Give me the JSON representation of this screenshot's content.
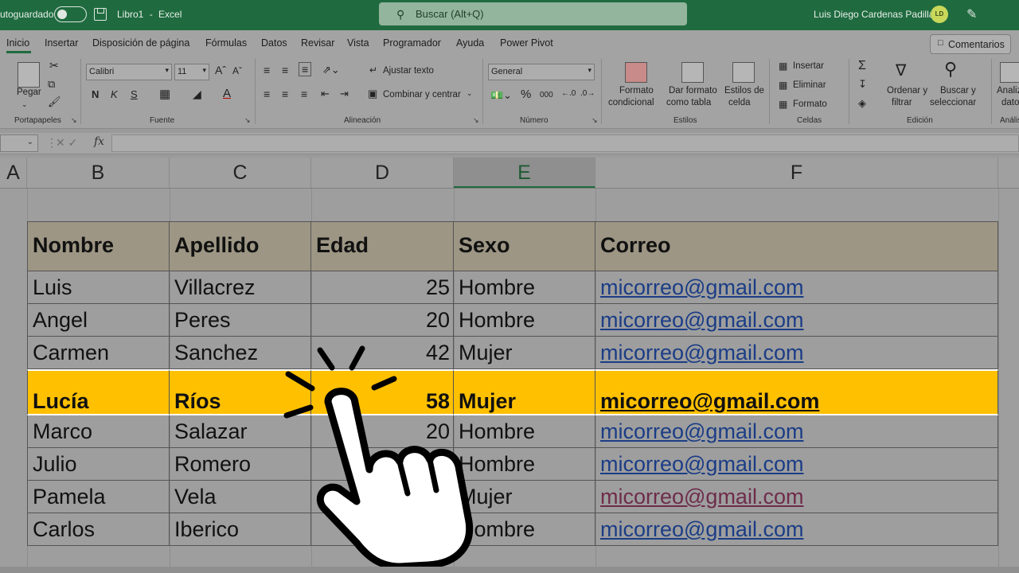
{
  "titlebar": {
    "autosave_label": "utoguardado",
    "doc_name": "Libro1",
    "sep": "-",
    "app_name": "Excel",
    "search_placeholder": "Buscar (Alt+Q)",
    "user_name": "Luis Diego Cardenas Padilla",
    "user_initials": "LD"
  },
  "ribbon": {
    "tabs": [
      "Inicio",
      "Insertar",
      "Disposición de página",
      "Fórmulas",
      "Datos",
      "Revisar",
      "Vista",
      "Programador",
      "Ayuda",
      "Power Pivot"
    ],
    "comments_label": "Comentarios",
    "clipboard": {
      "paste_label": "Pegar",
      "group_label": "Portapapeles"
    },
    "font": {
      "name": "Calibri",
      "size": "11",
      "bold": "N",
      "italic": "K",
      "underline": "S",
      "group_label": "Fuente"
    },
    "alignment": {
      "wrap_text": "Ajustar texto",
      "merge_center": "Combinar y centrar",
      "group_label": "Alineación"
    },
    "number": {
      "format": "General",
      "percent": "%",
      "thousands": "000",
      "group_label": "Número"
    },
    "styles": {
      "conditional_format_l1": "Formato",
      "conditional_format_l2": "condicional",
      "format_table_l1": "Dar formato",
      "format_table_l2": "como tabla",
      "cell_styles_l1": "Estilos de",
      "cell_styles_l2": "celda",
      "group_label": "Estilos"
    },
    "cells": {
      "insert": "Insertar",
      "delete": "Eliminar",
      "format": "Formato",
      "group_label": "Celdas"
    },
    "editing": {
      "sort_l1": "Ordenar y",
      "sort_l2": "filtrar",
      "find_l1": "Buscar y",
      "find_l2": "seleccionar",
      "group_label": "Edición"
    },
    "analysis": {
      "label_l1": "Analiz",
      "label_l2": "dato",
      "group_label": "Anális"
    }
  },
  "formula_bar": {
    "fx": "fx",
    "value": ""
  },
  "columns": [
    "A",
    "B",
    "C",
    "D",
    "E",
    "F"
  ],
  "table": {
    "headers": [
      "Nombre",
      "Apellido",
      "Edad",
      "Sexo",
      "Correo"
    ],
    "rows": [
      [
        "Luis",
        "Villacrez",
        "25",
        "Hombre",
        "micorreo@gmail.com"
      ],
      [
        "Angel",
        "Peres",
        "20",
        "Hombre",
        "micorreo@gmail.com"
      ],
      [
        "Carmen",
        "Sanchez",
        "42",
        "Mujer",
        "micorreo@gmail.com"
      ],
      [
        "Lucía",
        "Ríos",
        "58",
        "Mujer",
        "micorreo@gmail.com"
      ],
      [
        "Marco",
        "Salazar",
        "20",
        "Hombre",
        "micorreo@gmail.com"
      ],
      [
        "Julio",
        "Romero",
        "",
        "Hombre",
        "micorreo@gmail.com"
      ],
      [
        "Pamela",
        "Vela",
        "",
        "Mujer",
        "micorreo@gmail.com"
      ],
      [
        "Carlos",
        "Iberico",
        "",
        "Hombre",
        "micorreo@gmail.com"
      ]
    ]
  },
  "colors": {
    "title_green": "#1f6b3f",
    "highlight": "#ffc000",
    "header_fill": "#9d9684",
    "link": "#1b3d86"
  }
}
